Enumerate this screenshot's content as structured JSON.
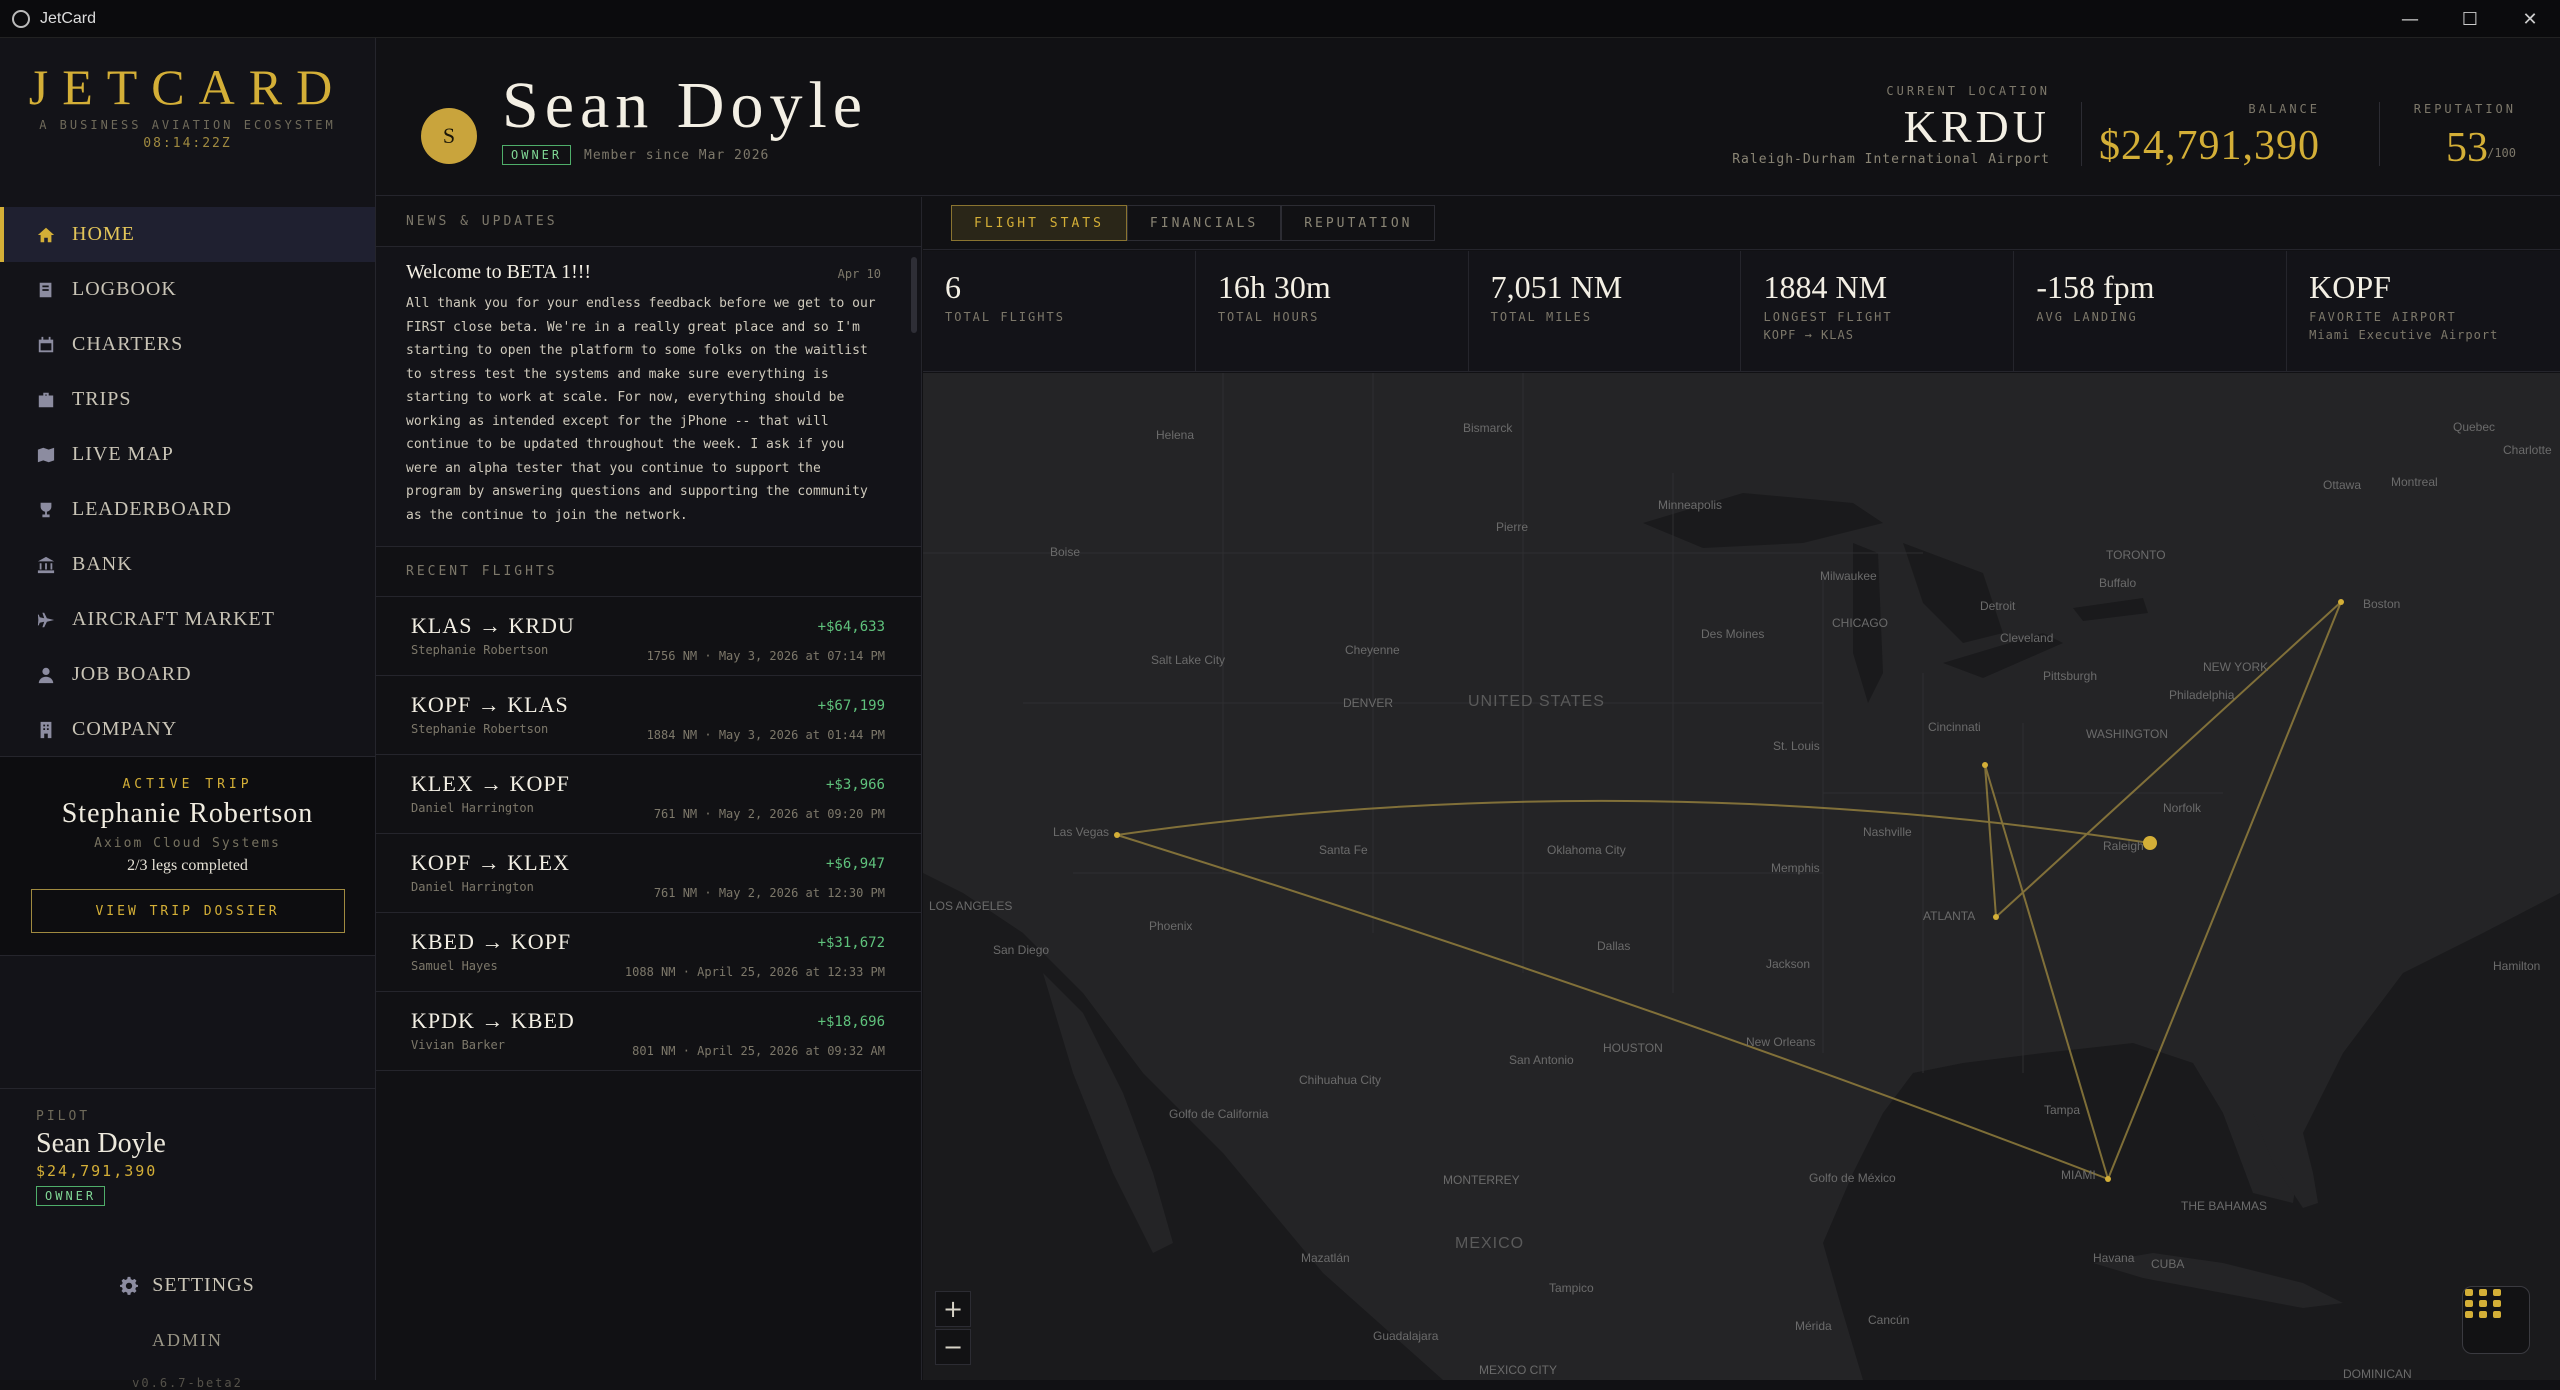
{
  "window": {
    "title": "JetCard",
    "minimize": "—",
    "maximize": "☐",
    "close": "✕"
  },
  "brand": {
    "logo": "JETCARD",
    "tagline": "A BUSINESS AVIATION ECOSYSTEM",
    "clock": "08:14:22Z"
  },
  "nav": [
    {
      "label": "HOME",
      "icon": "home-icon"
    },
    {
      "label": "LOGBOOK",
      "icon": "book-icon"
    },
    {
      "label": "CHARTERS",
      "icon": "calendar-icon"
    },
    {
      "label": "TRIPS",
      "icon": "suitcase-icon"
    },
    {
      "label": "LIVE MAP",
      "icon": "map-icon"
    },
    {
      "label": "LEADERBOARD",
      "icon": "trophy-icon"
    },
    {
      "label": "BANK",
      "icon": "bank-icon"
    },
    {
      "label": "AIRCRAFT MARKET",
      "icon": "plane-icon"
    },
    {
      "label": "JOB BOARD",
      "icon": "person-icon"
    },
    {
      "label": "COMPANY",
      "icon": "building-icon"
    }
  ],
  "active_trip": {
    "label": "ACTIVE TRIP",
    "name": "Stephanie Robertson",
    "company": "Axiom Cloud Systems",
    "legs": "2/3 legs completed",
    "button": "VIEW TRIP DOSSIER"
  },
  "pilot": {
    "label": "PILOT",
    "name": "Sean Doyle",
    "balance": "$24,791,390",
    "role": "OWNER"
  },
  "footer": {
    "settings": "SETTINGS",
    "admin": "ADMIN",
    "version": "v0.6.7-beta2"
  },
  "header": {
    "avatar_initial": "S",
    "name": "Sean Doyle",
    "role": "OWNER",
    "member_since": "Member since Mar 2026",
    "location_label": "CURRENT LOCATION",
    "location_code": "KRDU",
    "location_airport": "Raleigh-Durham International Airport",
    "balance_label": "BALANCE",
    "balance": "$24,791,390",
    "reputation_label": "REPUTATION",
    "reputation": "53",
    "reputation_max": "/100"
  },
  "news": {
    "label": "NEWS & UPDATES",
    "title": "Welcome to BETA 1!!!",
    "date": "Apr 10",
    "body": "All thank you for your endless feedback before we get to our FIRST close beta. We're in a really great place and so I'm starting to open the platform to some folks on the waitlist to stress test the systems and make sure everything is starting to work at scale. For now, everything should be working as intended except for the jPhone -- that will continue to be updated throughout the week. I ask if you were an alpha tester that you continue to support the program by answering questions and supporting the community as the continue to join the network."
  },
  "recent_flights": {
    "label": "RECENT FLIGHTS",
    "items": [
      {
        "route": "KLAS → KRDU",
        "amount": "+$64,633",
        "pilot": "Stephanie Robertson",
        "meta": "1756 NM · May 3, 2026 at 07:14 PM"
      },
      {
        "route": "KOPF → KLAS",
        "amount": "+$67,199",
        "pilot": "Stephanie Robertson",
        "meta": "1884 NM · May 3, 2026 at 01:44 PM"
      },
      {
        "route": "KLEX → KOPF",
        "amount": "+$3,966",
        "pilot": "Daniel Harrington",
        "meta": "761 NM · May 2, 2026 at 09:20 PM"
      },
      {
        "route": "KOPF → KLEX",
        "amount": "+$6,947",
        "pilot": "Daniel Harrington",
        "meta": "761 NM · May 2, 2026 at 12:30 PM"
      },
      {
        "route": "KBED → KOPF",
        "amount": "+$31,672",
        "pilot": "Samuel Hayes",
        "meta": "1088 NM · April 25, 2026 at 12:33 PM"
      },
      {
        "route": "KPDK → KBED",
        "amount": "+$18,696",
        "pilot": "Vivian Barker",
        "meta": "801 NM · April 25, 2026 at 09:32 AM"
      }
    ]
  },
  "tabs": [
    {
      "label": "FLIGHT STATS",
      "active": true
    },
    {
      "label": "FINANCIALS",
      "active": false
    },
    {
      "label": "REPUTATION",
      "active": false
    }
  ],
  "stats": [
    {
      "value": "6",
      "label": "TOTAL FLIGHTS",
      "sub": ""
    },
    {
      "value": "16h 30m",
      "label": "TOTAL HOURS",
      "sub": ""
    },
    {
      "value": "7,051 NM",
      "label": "TOTAL MILES",
      "sub": ""
    },
    {
      "value": "1884 NM",
      "label": "LONGEST FLIGHT",
      "sub": "KOPF → KLAS"
    },
    {
      "value": "-158 fpm",
      "label": "AVG LANDING",
      "sub": ""
    },
    {
      "value": "KOPF",
      "label": "FAVORITE AIRPORT",
      "sub": "Miami Executive Airport"
    }
  ],
  "map": {
    "zoom_in": "+",
    "zoom_out": "−",
    "labels": [
      "Helena",
      "Bismarck",
      "Minneapolis",
      "Pierre",
      "Boise",
      "Milwaukee",
      "TORONTO",
      "Ottawa",
      "Montreal",
      "Quebec",
      "Charlotte",
      "Buffalo",
      "Detroit",
      "Cleveland",
      "CHICAGO",
      "Des Moines",
      "Cheyenne",
      "Salt Lake City",
      "DENVER",
      "UNITED STATES",
      "Pittsburgh",
      "NEW YORK",
      "Philadelphia",
      "WASHINGTON",
      "Boston",
      "Cincinnati",
      "St. Louis",
      "Nashville",
      "Norfolk",
      "Raleigh",
      "Las Vegas",
      "Santa Fe",
      "Oklahoma City",
      "Memphis",
      "LOS ANGELES",
      "San Diego",
      "Phoenix",
      "ATLANTA",
      "Dallas",
      "Jackson",
      "New Orleans",
      "HOUSTON",
      "San Antonio",
      "Golfo de California",
      "Chihuahua City",
      "Tampa",
      "MIAMI",
      "Golfo de México",
      "MONTERREY",
      "THE BAHAMAS",
      "MEXICO",
      "Havana",
      "CUBA",
      "Mazatlán",
      "Tampico",
      "Guadalajara",
      "Mérida",
      "Cancún",
      "MEXICO CITY",
      "Hamilton",
      "DOMINICAN"
    ]
  },
  "colors": {
    "accent": "#d4af37",
    "positive": "#5fc27c",
    "background": "#111114"
  }
}
